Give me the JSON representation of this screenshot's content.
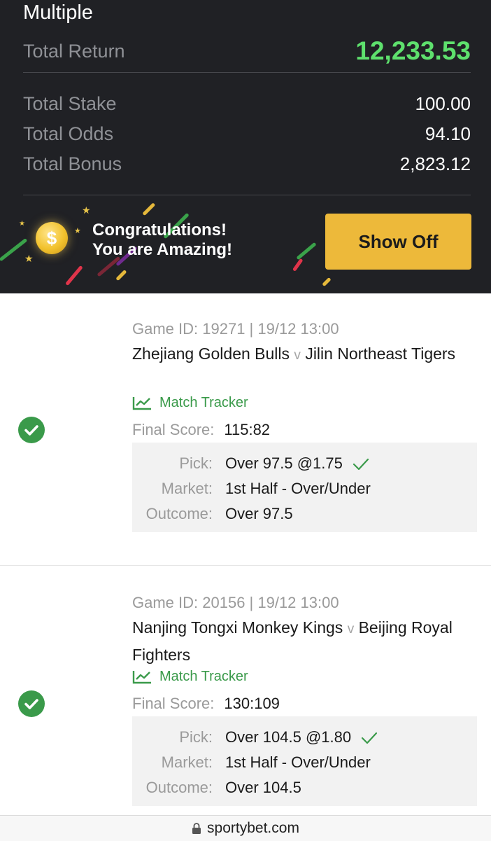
{
  "summary": {
    "title": "Multiple",
    "total_return_label": "Total Return",
    "total_return": "12,233.53",
    "total_stake_label": "Total Stake",
    "total_stake": "100.00",
    "total_odds_label": "Total Odds",
    "total_odds": "94.10",
    "total_bonus_label": "Total Bonus",
    "total_bonus": "2,823.12",
    "return_color": "#5ee06d"
  },
  "banner": {
    "line1": "Congratulations!",
    "line2": "You are Amazing!",
    "coin_symbol": "$",
    "button_label": "Show Off",
    "button_color": "#edb93a"
  },
  "legs": [
    {
      "status": "won",
      "game_id": "Game ID: 19271 | 19/12 13:00",
      "home": "Zhejiang Golden Bulls",
      "vs": "v",
      "away": "Jilin Northeast Tigers",
      "tracker_label": "Match Tracker",
      "final_score_label": "Final Score:",
      "final_score": "115:82",
      "pick_label": "Pick:",
      "pick": "Over 97.5 @1.75",
      "market_label": "Market:",
      "market": "1st Half - Over/Under",
      "outcome_label": "Outcome:",
      "outcome": "Over 97.5"
    },
    {
      "status": "won",
      "game_id": "Game ID: 20156 | 19/12 13:00",
      "home": "Nanjing Tongxi Monkey Kings",
      "vs": "v",
      "away": "Beijing Royal Fighters",
      "tracker_label": "Match Tracker",
      "final_score_label": "Final Score:",
      "final_score": "130:109",
      "pick_label": "Pick:",
      "pick": "Over 104.5 @1.80",
      "market_label": "Market:",
      "market": "1st Half - Over/Under",
      "outcome_label": "Outcome:",
      "outcome": "Over 104.5"
    }
  ],
  "browser": {
    "url": "sportybet.com",
    "lock_icon": "lock-icon"
  },
  "colors": {
    "header_bg": "#202125",
    "win_green": "#3a9a4a",
    "pick_box_bg": "#f2f2f2"
  }
}
